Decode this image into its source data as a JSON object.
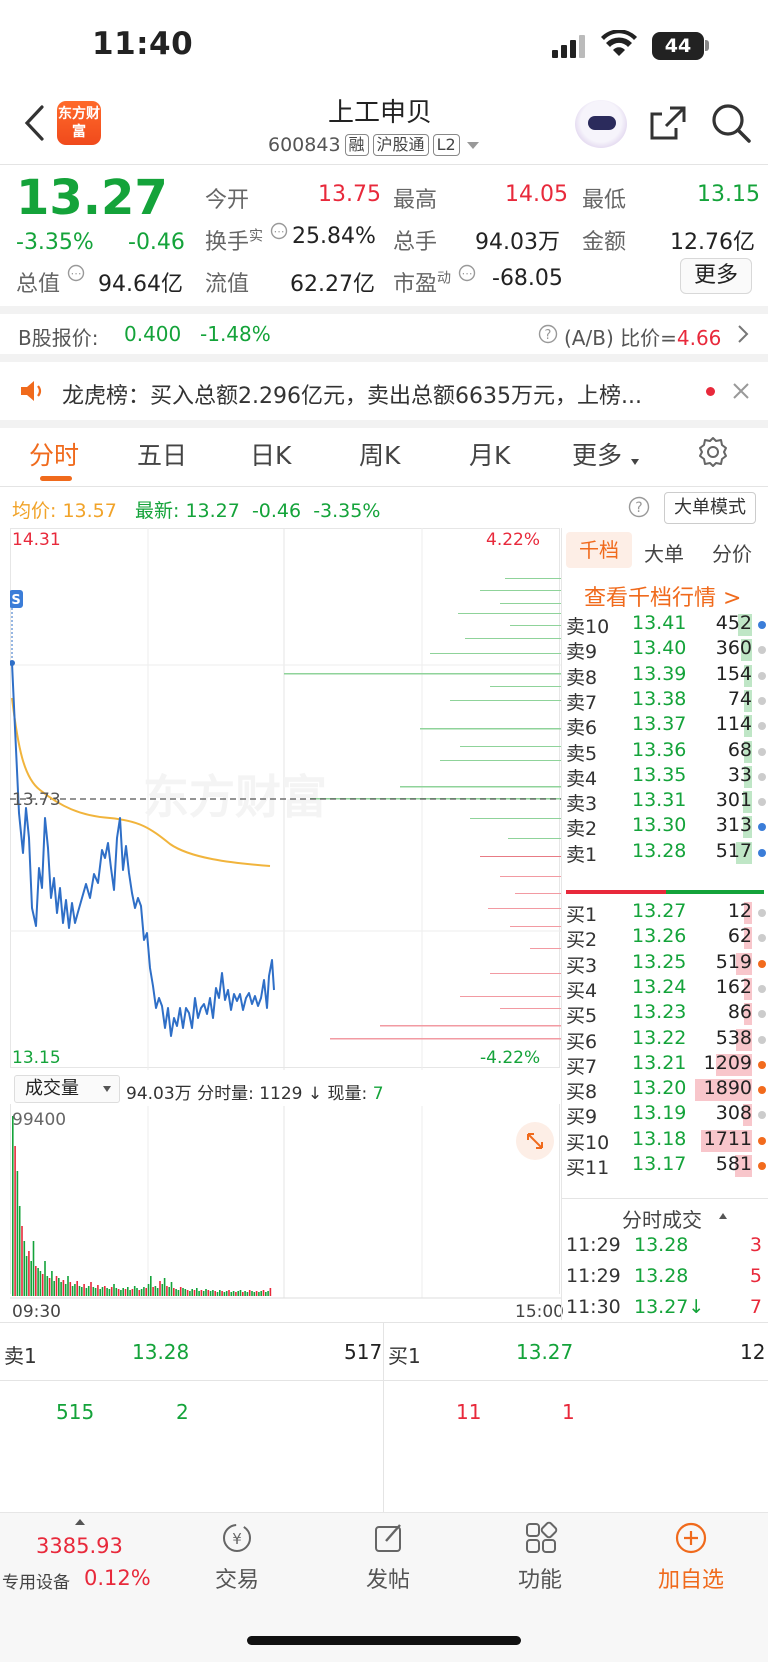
{
  "status": {
    "time": "11:40",
    "battery": "44"
  },
  "nav": {
    "logo_text": "东方财富",
    "name": "上工申贝",
    "code": "600843",
    "tags": [
      "融",
      "沪股通",
      "L2"
    ]
  },
  "quote": {
    "price": "13.27",
    "change_pct": "-3.35%",
    "change": "-0.46",
    "fields": [
      {
        "label": "今开",
        "value": "13.75"
      },
      {
        "label": "最高",
        "value": "14.05"
      },
      {
        "label": "最低",
        "value": "13.15"
      },
      {
        "label": "换手",
        "sup": "实",
        "value": "25.84%"
      },
      {
        "label": "总手",
        "value": "94.03万"
      },
      {
        "label": "金额",
        "value": "12.76亿"
      },
      {
        "label": "总值",
        "value": "94.64亿"
      },
      {
        "label": "流值",
        "value": "62.27亿"
      },
      {
        "label": "市盈",
        "sup": "动",
        "value": "-68.05"
      }
    ],
    "more_label": "更多"
  },
  "b_share": {
    "label": "B股报价:",
    "price": "0.400",
    "pct": "-1.48%",
    "ratio_label": "(A/B) 比价=",
    "ratio": "4.66"
  },
  "dragon": {
    "label": "龙虎榜：",
    "text": "买入总额2.296亿元，卖出总额6635万元，上榜..."
  },
  "tabs": [
    "分时",
    "五日",
    "日K",
    "周K",
    "月K",
    "更多"
  ],
  "chart_info": {
    "avg_label": "均价:",
    "avg_value": "13.57",
    "latest_label": "最新:",
    "latest_value": "13.27",
    "latest_change": "-0.46",
    "latest_pct": "-3.35%",
    "mode_button": "大单模式",
    "max_price": "14.31",
    "min_price": "13.15",
    "prev_close": "13.73",
    "max_pct": "4.22%",
    "min_pct": "-4.22%",
    "watermark": "东方财富"
  },
  "volume_info": {
    "selector": "成交量",
    "total": "94.03万",
    "minute_label": "分时量:",
    "minute_value": "1129 ↓",
    "current_label": "现量:",
    "current_value": "7",
    "max_label": "99400",
    "time_start": "09:30",
    "time_end": "15:00"
  },
  "orderbook": {
    "tabs": [
      "千档",
      "大单",
      "分价"
    ],
    "link": "查看千档行情 >",
    "asks": [
      {
        "label": "卖10",
        "price": "13.41",
        "vol": "452",
        "dot": "#3b7dd8"
      },
      {
        "label": "卖9",
        "price": "13.40",
        "vol": "360",
        "dot": "#cccccc"
      },
      {
        "label": "卖8",
        "price": "13.39",
        "vol": "154",
        "dot": "#cccccc"
      },
      {
        "label": "卖7",
        "price": "13.38",
        "vol": "74",
        "dot": "#cccccc"
      },
      {
        "label": "卖6",
        "price": "13.37",
        "vol": "114",
        "dot": "#cccccc"
      },
      {
        "label": "卖5",
        "price": "13.36",
        "vol": "68",
        "dot": "#cccccc"
      },
      {
        "label": "卖4",
        "price": "13.35",
        "vol": "33",
        "dot": "#cccccc"
      },
      {
        "label": "卖3",
        "price": "13.31",
        "vol": "301",
        "dot": "#cccccc"
      },
      {
        "label": "卖2",
        "price": "13.30",
        "vol": "313",
        "dot": "#3b7dd8"
      },
      {
        "label": "卖1",
        "price": "13.28",
        "vol": "517",
        "dot": "#3b7dd8"
      }
    ],
    "bids": [
      {
        "label": "买1",
        "price": "13.27",
        "vol": "12",
        "dot": "#cccccc"
      },
      {
        "label": "买2",
        "price": "13.26",
        "vol": "62",
        "dot": "#cccccc"
      },
      {
        "label": "买3",
        "price": "13.25",
        "vol": "519",
        "dot": "#f26b1d"
      },
      {
        "label": "买4",
        "price": "13.24",
        "vol": "162",
        "dot": "#cccccc"
      },
      {
        "label": "买5",
        "price": "13.23",
        "vol": "86",
        "dot": "#cccccc"
      },
      {
        "label": "买6",
        "price": "13.22",
        "vol": "538",
        "dot": "#cccccc"
      },
      {
        "label": "买7",
        "price": "13.21",
        "vol": "1209",
        "dot": "#f26b1d"
      },
      {
        "label": "买8",
        "price": "13.20",
        "vol": "1890",
        "dot": "#f26b1d"
      },
      {
        "label": "买9",
        "price": "13.19",
        "vol": "308",
        "dot": "#cccccc"
      },
      {
        "label": "买10",
        "price": "13.18",
        "vol": "1711",
        "dot": "#f26b1d"
      },
      {
        "label": "买11",
        "price": "13.17",
        "vol": "581",
        "dot": "#f26b1d"
      }
    ],
    "trades_title": "分时成交",
    "trades": [
      {
        "time": "11:29",
        "price": "13.28",
        "vol": "3"
      },
      {
        "time": "11:29",
        "price": "13.28",
        "vol": "5"
      },
      {
        "time": "11:30",
        "price": "13.27↓",
        "vol": "7"
      }
    ]
  },
  "bottom_quote": {
    "ask_label": "卖1",
    "ask_price": "13.28",
    "ask_vol": "517",
    "bid_label": "买1",
    "bid_price": "13.27",
    "bid_vol": "12",
    "left_a": "515",
    "left_b": "2",
    "right_a": "11",
    "right_b": "1"
  },
  "bottom_bar": {
    "index_value": "3385.93",
    "index_label": "专用设备",
    "index_pct": "0.12%",
    "items": [
      "交易",
      "发帖",
      "功能",
      "加自选"
    ]
  },
  "colors": {
    "up": "#e8293b",
    "down": "#14a33a",
    "accent": "#f06a1c",
    "avg_line": "#f1b43c",
    "price_line": "#2f6fc7"
  }
}
